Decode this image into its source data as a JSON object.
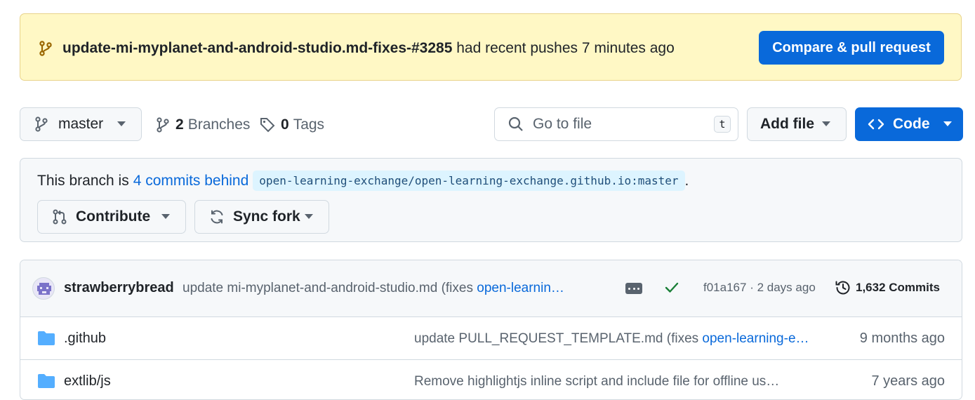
{
  "banner": {
    "branch_name": "update-mi-myplanet-and-android-studio.md-fixes-#3285",
    "message": "had recent pushes 7 minutes ago",
    "button": "Compare & pull request"
  },
  "toolbar": {
    "branch": "master",
    "branches_count": "2",
    "branches_label": "Branches",
    "tags_count": "0",
    "tags_label": "Tags",
    "search_placeholder": "Go to file",
    "search_shortcut": "t",
    "add_file": "Add file",
    "code": "Code"
  },
  "fork": {
    "prefix": "This branch is",
    "behind_link": "4 commits behind",
    "upstream_ref": "open-learning-exchange/open-learning-exchange.github.io:master",
    "suffix": ".",
    "contribute": "Contribute",
    "sync_fork": "Sync fork"
  },
  "latest_commit": {
    "author": "strawberrybread",
    "message": "update mi-myplanet-and-android-studio.md (fixes ",
    "message_link": "open-learnin…",
    "sha": "f01a167",
    "separator": "·",
    "time": "2 days ago",
    "commits_label": "1,632 Commits"
  },
  "files": [
    {
      "name": ".github",
      "message": "update PULL_REQUEST_TEMPLATE.md (fixes ",
      "message_link": "open-learning-e…",
      "date": "9 months ago"
    },
    {
      "name": "extlib/js",
      "message": "Remove highlightjs inline script and include file for offline us…",
      "message_link": "",
      "date": "7 years ago"
    }
  ],
  "colors": {
    "accent": "#0969da",
    "banner_bg": "#fff8c5",
    "success": "#1a7f37",
    "folder": "#54aeff"
  }
}
